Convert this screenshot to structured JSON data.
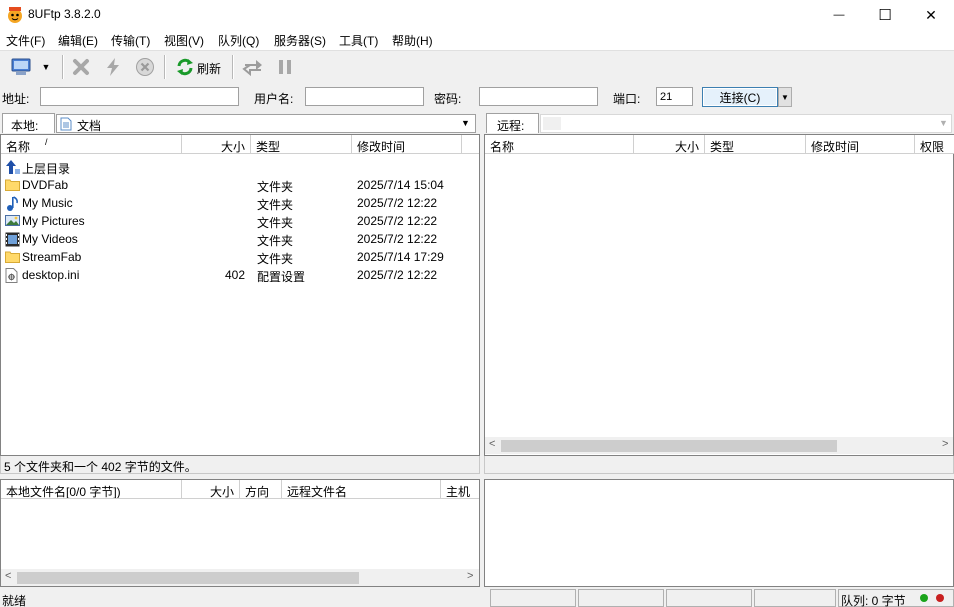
{
  "window": {
    "title": "8UFtp 3.8.2.0",
    "minimize_glyph": "—",
    "maximize_glyph": "☐",
    "close_glyph": "✕"
  },
  "menu": [
    "文件(F)",
    "编辑(E)",
    "传输(T)",
    "视图(V)",
    "队列(Q)",
    "服务器(S)",
    "工具(T)",
    "帮助(H)"
  ],
  "toolbar": {
    "refresh_label": "刷新",
    "icons": [
      "site-manager-icon",
      "disconnect-icon",
      "quick-connect-icon",
      "stop-icon",
      "refresh-icon",
      "sync-browse-icon",
      "pause-icon"
    ]
  },
  "address_bar": {
    "address_label": "地址:",
    "address_value": "",
    "username_label": "用户名:",
    "username_value": "",
    "password_label": "密码:",
    "password_value": "",
    "port_label": "端口:",
    "port_value": "21",
    "connect_label": "连接(C)"
  },
  "local": {
    "label": "本地:",
    "path": "文档",
    "columns": [
      "名称",
      "大小",
      "类型",
      "修改时间"
    ],
    "sort_indicator": "/",
    "parent_dir": "上层目录",
    "files": [
      {
        "name": "DVDFab",
        "size": "",
        "type": "文件夹",
        "modified": "2025/7/14 15:04",
        "icon": "folder-icon"
      },
      {
        "name": "My Music",
        "size": "",
        "type": "文件夹",
        "modified": "2025/7/2 12:22",
        "icon": "music-folder-icon"
      },
      {
        "name": "My Pictures",
        "size": "",
        "type": "文件夹",
        "modified": "2025/7/2 12:22",
        "icon": "pictures-folder-icon"
      },
      {
        "name": "My Videos",
        "size": "",
        "type": "文件夹",
        "modified": "2025/7/2 12:22",
        "icon": "videos-folder-icon"
      },
      {
        "name": "StreamFab",
        "size": "",
        "type": "文件夹",
        "modified": "2025/7/14 17:29",
        "icon": "folder-icon"
      },
      {
        "name": "desktop.ini",
        "size": "402",
        "type": "配置设置",
        "modified": "2025/7/2 12:22",
        "icon": "ini-file-icon"
      }
    ],
    "status": "5 个文件夹和一个 402 字节的文件。"
  },
  "remote": {
    "label": "远程:",
    "path": "",
    "columns": [
      "名称",
      "大小",
      "类型",
      "修改时间",
      "权限"
    ]
  },
  "queue": {
    "columns": [
      "本地文件名[0/0 字节])",
      "大小",
      "方向",
      "远程文件名",
      "主机"
    ]
  },
  "statusbar": {
    "ready": "就绪",
    "queue_info": "队列: 0 字节"
  },
  "colors": {
    "led_green": "#1aa31a",
    "led_red": "#c82020",
    "refresh_green": "#1a9a2a",
    "accent_border": "#3c7fb1"
  }
}
